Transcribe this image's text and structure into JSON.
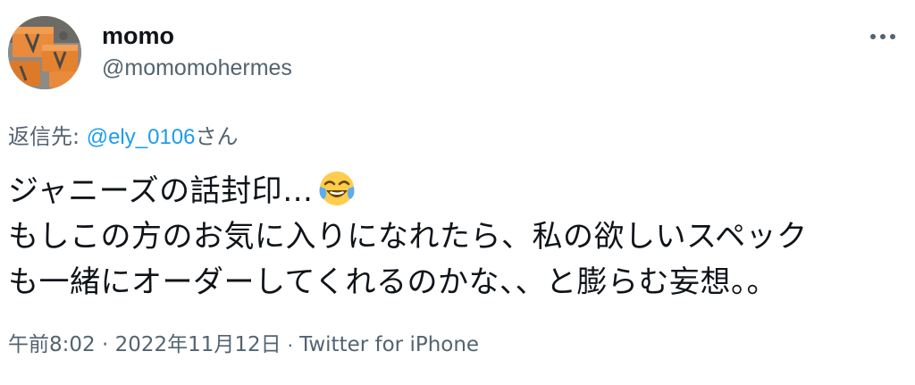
{
  "tweet": {
    "display_name": "momo",
    "handle": "@momomohermes",
    "reply_prefix": "返信先: ",
    "reply_mention": "@ely_0106",
    "reply_suffix": "さん",
    "text_lines": [
      "ジャニーズの話封印…",
      "もしこの方のお気に入りになれたら、私の欲しいスペック",
      "も一緒にオーダーしてくれるのかな、、と膨らむ妄想。。"
    ],
    "emoji_icon": "face-with-tears-of-joy-emoji",
    "timestamp": "午前8:02 · 2022年11月12日",
    "separator": " · ",
    "source": "Twitter for iPhone"
  },
  "colors": {
    "text": "#0f1419",
    "secondary": "#536471",
    "link": "#1d9bf0"
  },
  "icons": {
    "avatar": "avatar",
    "more": "more-dots-icon"
  }
}
